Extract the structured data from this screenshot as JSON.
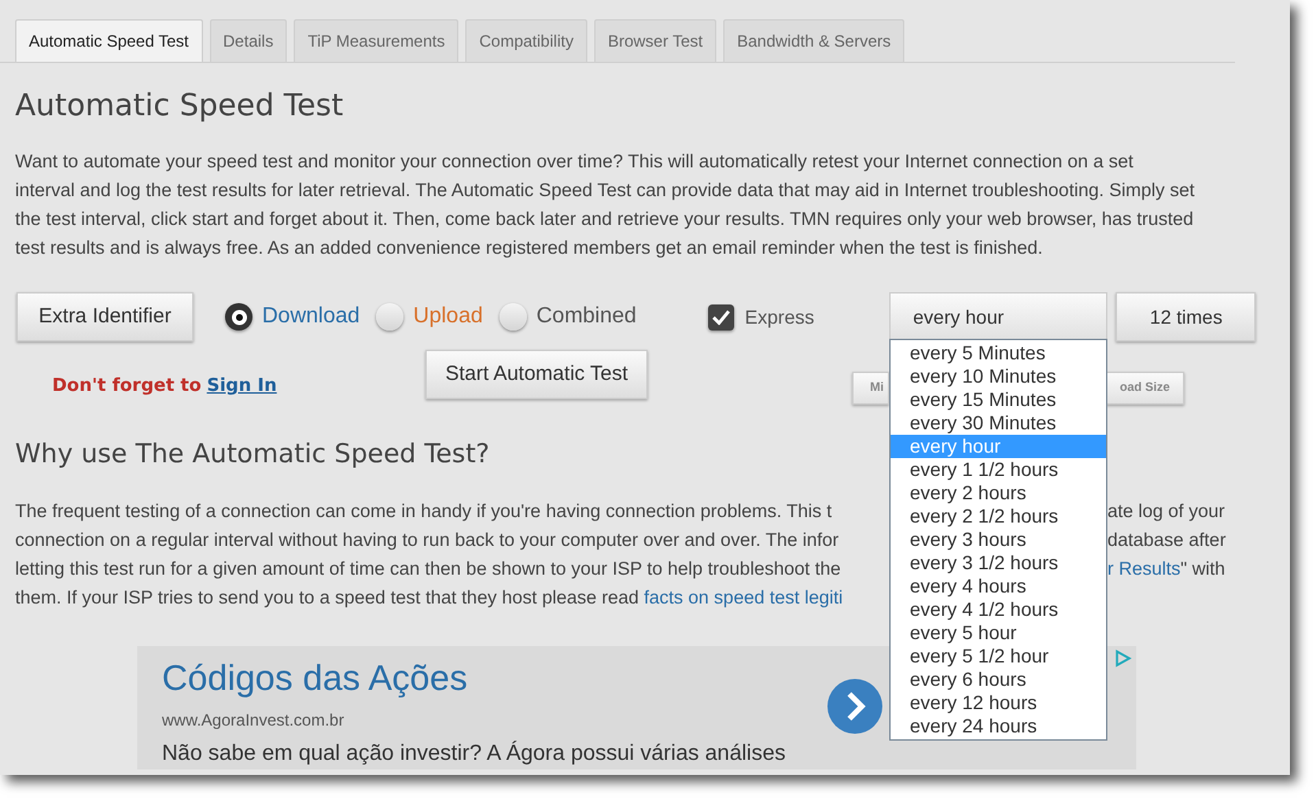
{
  "tabs": [
    {
      "label": "Automatic Speed Test",
      "selected": true
    },
    {
      "label": "Details",
      "selected": false
    },
    {
      "label": "TiP Measurements",
      "selected": false
    },
    {
      "label": "Compatibility",
      "selected": false
    },
    {
      "label": "Browser Test",
      "selected": false
    },
    {
      "label": "Bandwidth & Servers",
      "selected": false
    }
  ],
  "title": "Automatic Speed Test",
  "intro": "Want to automate your speed test and monitor your connection over time? This will automatically retest your Internet connection on a set interval and log the test results for later retrieval. The Automatic Speed Test can provide data that may aid in Internet troubleshooting. Simply set the test interval, click start and forget about it. Then, come back later and retrieve your results. TMN requires only your web browser, has trusted test results and is always free. As an added convenience registered members get an email reminder when the test is finished.",
  "identifier_button": "Extra Identifier",
  "test_types": [
    {
      "label": "Download",
      "selected": true,
      "color": "#2a6ea8"
    },
    {
      "label": "Upload",
      "selected": false,
      "color": "#d8702a"
    },
    {
      "label": "Combined",
      "selected": false,
      "color": "#555555"
    }
  ],
  "express": {
    "label": "Express",
    "checked": true
  },
  "interval": {
    "value": "every hour",
    "expanded": true,
    "options": [
      {
        "label": "every 5 Minutes",
        "selected": false
      },
      {
        "label": "every 10 Minutes",
        "selected": false
      },
      {
        "label": "every 15 Minutes",
        "selected": false
      },
      {
        "label": "every 30 Minutes",
        "selected": false
      },
      {
        "label": "every hour",
        "selected": true
      },
      {
        "label": "every 1 1/2 hours",
        "selected": false
      },
      {
        "label": "every 2 hours",
        "selected": false
      },
      {
        "label": "every 2 1/2 hours",
        "selected": false
      },
      {
        "label": "every 3 hours",
        "selected": false
      },
      {
        "label": "every 3 1/2 hours",
        "selected": false
      },
      {
        "label": "every 4 hours",
        "selected": false
      },
      {
        "label": "every 4 1/2 hours",
        "selected": false
      },
      {
        "label": "every 5 hour",
        "selected": false
      },
      {
        "label": "every 5 1/2 hour",
        "selected": false
      },
      {
        "label": "every 6 hours",
        "selected": false
      },
      {
        "label": "every 12 hours",
        "selected": false
      },
      {
        "label": "every 24 hours",
        "selected": false
      }
    ]
  },
  "count": "12 times",
  "sign_in": {
    "prefix": "Don't forget to",
    "link": "Sign In"
  },
  "start_button": "Start Automatic Test",
  "partial_buttons": [
    "Mi",
    "oad Size"
  ],
  "heading2": "Why use The Automatic Speed Test?",
  "lines": [
    {
      "left": [
        {
          "text": "The frequent testing of a connection can come in handy if you're having connection problems.  This t",
          "link": false
        }
      ],
      "right": [
        {
          "text": "ate log of your",
          "link": false
        }
      ]
    },
    {
      "left": [
        {
          "text": "connection on a regular interval without having to run back to your computer over and over. The infor",
          "link": false
        }
      ],
      "right": [
        {
          "text": "database after",
          "link": false
        }
      ]
    },
    {
      "left": [
        {
          "text": "letting this test run for a given amount of time can then be shown to your ISP to help troubleshoot the",
          "link": false
        }
      ],
      "right": [
        {
          "text": "r Results",
          "link": true
        },
        {
          "text": "\" with",
          "link": false
        }
      ]
    },
    {
      "left": [
        {
          "text": "them. If your ISP tries to send you to a speed test that they host please read ",
          "link": false
        },
        {
          "text": "facts on speed test legiti",
          "link": true
        }
      ]
    }
  ],
  "ad": {
    "title": "Códigos das Ações",
    "url": "www.AgoraInvest.com.br",
    "text": "Não sabe em qual ação investir? A Ágora possui várias análises"
  }
}
